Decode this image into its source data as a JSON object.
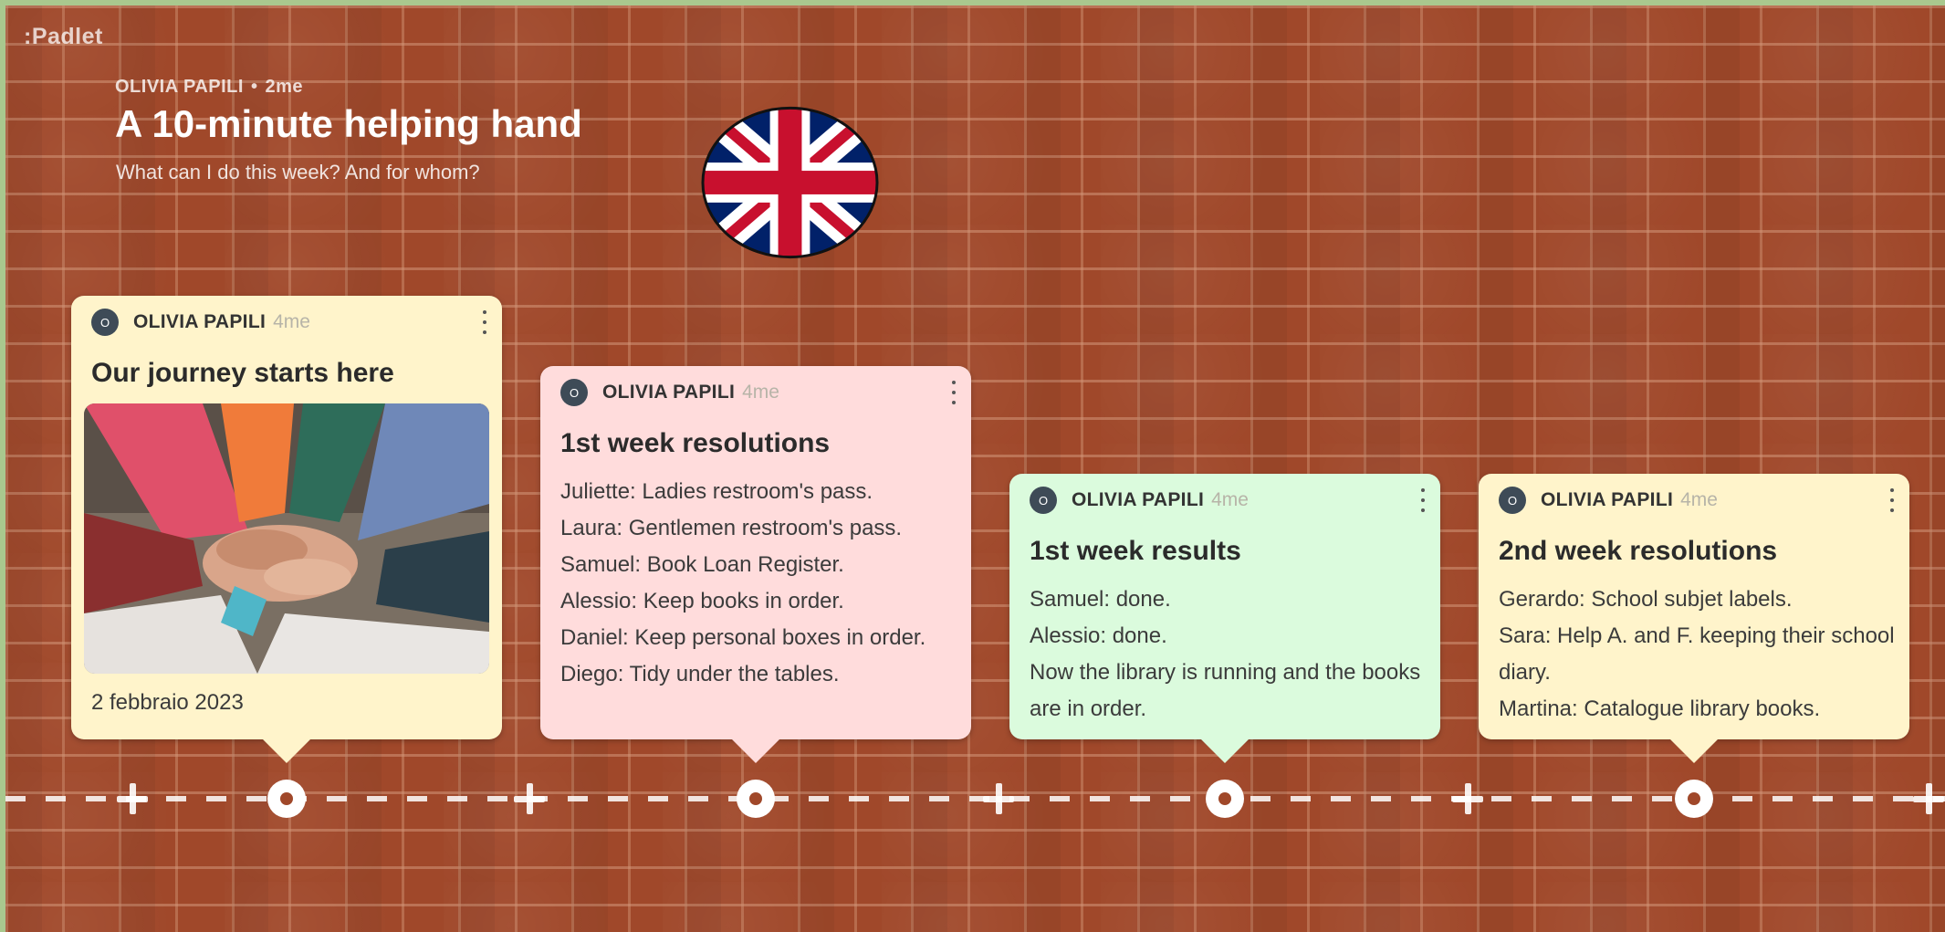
{
  "app": {
    "logo": ":Padlet"
  },
  "header": {
    "author": "OLIVIA PAPILI",
    "separator": "•",
    "time": "2me",
    "title": "A 10-minute helping hand",
    "subtitle": "What can I do this week? And for whom?"
  },
  "flag_icon": "union-jack-flag",
  "colors": {
    "background_brick": "#a0482a",
    "card_yellow": "#fff4cb",
    "card_pink": "#ffdcdc",
    "card_green": "#dbfbdd",
    "avatar": "#3e4b57"
  },
  "posts": [
    {
      "avatar": "O",
      "author": "OLIVIA PAPILI",
      "time": "4me",
      "title": "Our journey starts here",
      "image": "hands-stacked-together-photo",
      "date": "2 febbraio 2023"
    },
    {
      "avatar": "O",
      "author": "OLIVIA PAPILI",
      "time": "4me",
      "title": "1st week resolutions",
      "lines": [
        "Juliette: Ladies restroom's pass.",
        "Laura: Gentlemen restroom's pass.",
        "Samuel: Book Loan Register.",
        "Alessio: Keep books in order.",
        "Daniel: Keep personal boxes in order.",
        "Diego: Tidy under the tables."
      ]
    },
    {
      "avatar": "O",
      "author": "OLIVIA PAPILI",
      "time": "4me",
      "title": "1st week results",
      "lines": [
        "Samuel: done.",
        "Alessio: done.",
        "Now the library is running and the books are in order."
      ]
    },
    {
      "avatar": "O",
      "author": "OLIVIA PAPILI",
      "time": "4me",
      "title": "2nd week resolutions",
      "lines": [
        "Gerardo: School subjet labels.",
        "Sara: Help A. and F. keeping their school diary.",
        "Martina: Catalogue library books."
      ]
    }
  ]
}
